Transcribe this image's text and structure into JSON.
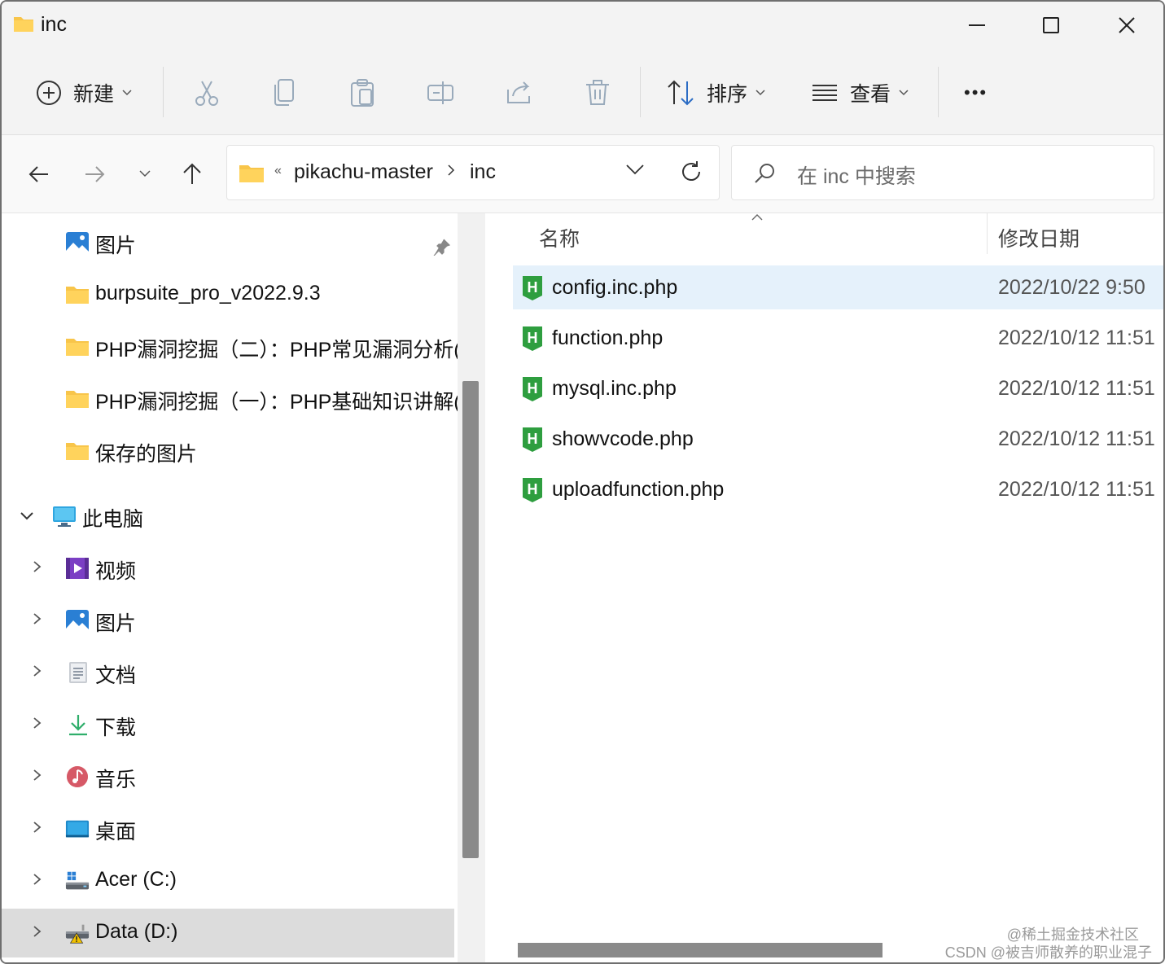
{
  "window": {
    "title": "inc"
  },
  "toolbar": {
    "new_label": "新建",
    "sort_label": "排序",
    "view_label": "查看",
    "more_label": "•••"
  },
  "address": {
    "overflow": "«",
    "segments": [
      "pikachu-master",
      "inc"
    ]
  },
  "search": {
    "placeholder": "在 inc 中搜索"
  },
  "sidebar": {
    "quick_access": [
      {
        "label": "图片",
        "icon": "pictures-icon",
        "pinned": true
      },
      {
        "label": "burpsuite_pro_v2022.9.3",
        "icon": "folder-icon"
      },
      {
        "label": "PHP漏洞挖掘（二）：PHP常见漏洞分析(",
        "icon": "folder-icon"
      },
      {
        "label": "PHP漏洞挖掘（一）：PHP基础知识讲解(",
        "icon": "folder-icon"
      },
      {
        "label": "保存的图片",
        "icon": "folder-icon"
      }
    ],
    "this_pc": {
      "label": "此电脑",
      "icon": "computer-icon",
      "expanded": true
    },
    "pc_items": [
      {
        "label": "视频",
        "icon": "videos-icon"
      },
      {
        "label": "图片",
        "icon": "pictures-icon"
      },
      {
        "label": "文档",
        "icon": "documents-icon"
      },
      {
        "label": "下载",
        "icon": "download-icon"
      },
      {
        "label": "音乐",
        "icon": "music-icon"
      },
      {
        "label": "桌面",
        "icon": "desktop-icon"
      },
      {
        "label": "Acer (C:)",
        "icon": "drive-c-icon"
      },
      {
        "label": "Data (D:)",
        "icon": "drive-d-warning-icon",
        "selected": true
      }
    ]
  },
  "filelist": {
    "columns": {
      "name": "名称",
      "date": "修改日期"
    },
    "files": [
      {
        "name": "config.inc.php",
        "date": "2022/10/22 9:50",
        "selected": true
      },
      {
        "name": "function.php",
        "date": "2022/10/12 11:51"
      },
      {
        "name": "mysql.inc.php",
        "date": "2022/10/12 11:51"
      },
      {
        "name": "showvcode.php",
        "date": "2022/10/12 11:51"
      },
      {
        "name": "uploadfunction.php",
        "date": "2022/10/12 11:51"
      }
    ]
  },
  "watermark": {
    "line1": "@稀土掘金技术社区",
    "line2": "CSDN @被吉师散养的职业混子"
  },
  "colors": {
    "selection_blue": "#e5f1fb",
    "sidebar_selected": "#dcdcdc",
    "php_icon_green": "#2e9e3f",
    "folder_yellow": "#f8c54a"
  }
}
